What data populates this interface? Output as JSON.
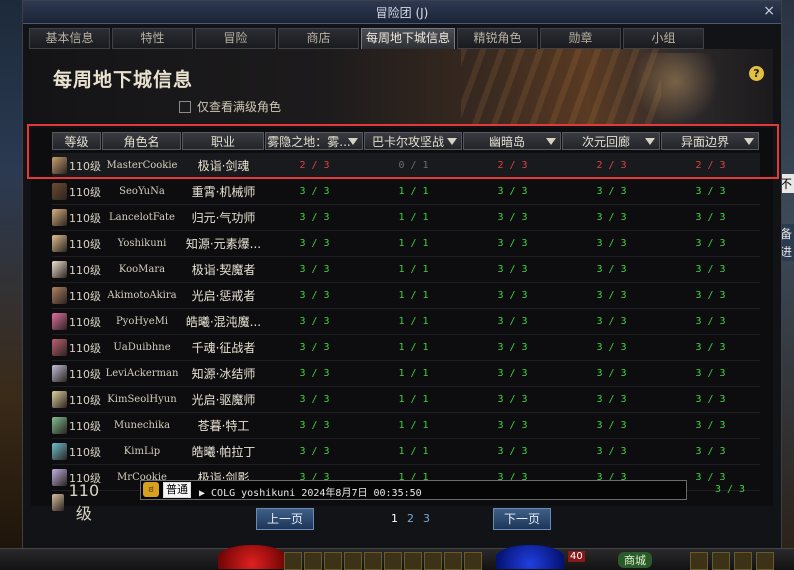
{
  "window": {
    "title": "冒险团 (J)",
    "close_label": "×"
  },
  "tabs": [
    {
      "label": "基本信息",
      "active": false
    },
    {
      "label": "特性",
      "active": false
    },
    {
      "label": "冒险",
      "active": false
    },
    {
      "label": "商店",
      "active": false
    },
    {
      "label": "每周地下城信息",
      "active": true
    },
    {
      "label": "精锐角色",
      "active": false
    },
    {
      "label": "勋章",
      "active": false
    },
    {
      "label": "小组",
      "active": false
    }
  ],
  "page": {
    "title": "每周地下城信息",
    "help_label": "?",
    "checkbox_label": "仅查看满级角色"
  },
  "table": {
    "headers": [
      "等级",
      "角色名",
      "职业",
      "雾隐之地：雾...",
      "巴卡尔攻坚战",
      "幽暗岛",
      "次元回廊",
      "异面边界"
    ],
    "rows": [
      {
        "level": "110级",
        "name": "MasterCookie",
        "job": "极诣·剑魂",
        "d": [
          "2 / 3",
          "0 / 1",
          "2 / 3",
          "2 / 3",
          "2 / 3"
        ],
        "s": [
          "bad",
          "dim",
          "bad",
          "bad",
          "bad"
        ],
        "avatar_color": "#c9a070"
      },
      {
        "level": "110级",
        "name": "SeoYuNa",
        "job": "重霄·机械师",
        "d": [
          "3 / 3",
          "1 / 1",
          "3 / 3",
          "3 / 3",
          "3 / 3"
        ],
        "s": [
          "ok",
          "ok",
          "ok",
          "ok",
          "ok"
        ],
        "avatar_color": "#704a30"
      },
      {
        "level": "110级",
        "name": "LancelotFate",
        "job": "归元·气功师",
        "d": [
          "3 / 3",
          "1 / 1",
          "3 / 3",
          "3 / 3",
          "3 / 3"
        ],
        "s": [
          "ok",
          "ok",
          "ok",
          "ok",
          "ok"
        ],
        "avatar_color": "#d8b080"
      },
      {
        "level": "110级",
        "name": "Yoshikuni",
        "job": "知源·元素爆...",
        "d": [
          "3 / 3",
          "1 / 1",
          "3 / 3",
          "3 / 3",
          "3 / 3"
        ],
        "s": [
          "ok",
          "ok",
          "ok",
          "ok",
          "ok"
        ],
        "avatar_color": "#e0c090"
      },
      {
        "level": "110级",
        "name": "KooMara",
        "job": "极诣·契魔者",
        "d": [
          "3 / 3",
          "1 / 1",
          "3 / 3",
          "3 / 3",
          "3 / 3"
        ],
        "s": [
          "ok",
          "ok",
          "ok",
          "ok",
          "ok"
        ],
        "avatar_color": "#f0e0d0"
      },
      {
        "level": "110级",
        "name": "AkimotoAkira",
        "job": "光启·惩戒者",
        "d": [
          "3 / 3",
          "1 / 1",
          "3 / 3",
          "3 / 3",
          "3 / 3"
        ],
        "s": [
          "ok",
          "ok",
          "ok",
          "ok",
          "ok"
        ],
        "avatar_color": "#b08060"
      },
      {
        "level": "110级",
        "name": "PyoHyeMi",
        "job": "皓曦·混沌魔...",
        "d": [
          "3 / 3",
          "1 / 1",
          "3 / 3",
          "3 / 3",
          "3 / 3"
        ],
        "s": [
          "ok",
          "ok",
          "ok",
          "ok",
          "ok"
        ],
        "avatar_color": "#e070a0"
      },
      {
        "level": "110级",
        "name": "UaDuibhne",
        "job": "千魂·征战者",
        "d": [
          "3 / 3",
          "1 / 1",
          "3 / 3",
          "3 / 3",
          "3 / 3"
        ],
        "s": [
          "ok",
          "ok",
          "ok",
          "ok",
          "ok"
        ],
        "avatar_color": "#c06070"
      },
      {
        "level": "110级",
        "name": "LeviAckerman",
        "job": "知源·冰结师",
        "d": [
          "3 / 3",
          "1 / 1",
          "3 / 3",
          "3 / 3",
          "3 / 3"
        ],
        "s": [
          "ok",
          "ok",
          "ok",
          "ok",
          "ok"
        ],
        "avatar_color": "#c0c0d8"
      },
      {
        "level": "110级",
        "name": "KimSeolHyun",
        "job": "光启·驱魔师",
        "d": [
          "3 / 3",
          "1 / 1",
          "3 / 3",
          "3 / 3",
          "3 / 3"
        ],
        "s": [
          "ok",
          "ok",
          "ok",
          "ok",
          "ok"
        ],
        "avatar_color": "#e0d0a0"
      },
      {
        "level": "110级",
        "name": "Munechika",
        "job": "苍暮·特工",
        "d": [
          "3 / 3",
          "1 / 1",
          "3 / 3",
          "3 / 3",
          "3 / 3"
        ],
        "s": [
          "ok",
          "ok",
          "ok",
          "ok",
          "ok"
        ],
        "avatar_color": "#80c090"
      },
      {
        "level": "110级",
        "name": "KimLip",
        "job": "皓曦·帕拉丁",
        "d": [
          "3 / 3",
          "1 / 1",
          "3 / 3",
          "3 / 3",
          "3 / 3"
        ],
        "s": [
          "ok",
          "ok",
          "ok",
          "ok",
          "ok"
        ],
        "avatar_color": "#70c0d0"
      },
      {
        "level": "110级",
        "name": "MrCookie",
        "job": "极诣·剑影",
        "d": [
          "3 / 3",
          "1 / 1",
          "3 / 3",
          "3 / 3",
          "3 / 3"
        ],
        "s": [
          "ok",
          "ok",
          "ok",
          "ok",
          "ok"
        ],
        "avatar_color": "#c0b0e0"
      }
    ],
    "last_row": {
      "level": "110级",
      "last_value": "3 / 3",
      "avatar_color": "#d8c0a0"
    }
  },
  "chat": {
    "face": "ಠ",
    "channel": "普通",
    "text": "▶ COLG yoshikuni 2024年8月7日 00:35:50"
  },
  "pager": {
    "prev_label": "上一页",
    "next_label": "下一页",
    "pages": [
      "1",
      "2",
      "3"
    ],
    "current": "1"
  },
  "side_snippets": {
    "right1": "不",
    "right2": "备",
    "right3": "进"
  },
  "hud": {
    "level_badge": "40",
    "shop_label": "商城"
  },
  "colors": {
    "ok": "#3fd23f",
    "bad": "#e04040",
    "highlight": "#e23a3a",
    "accent_blue": "#3f5f88"
  }
}
